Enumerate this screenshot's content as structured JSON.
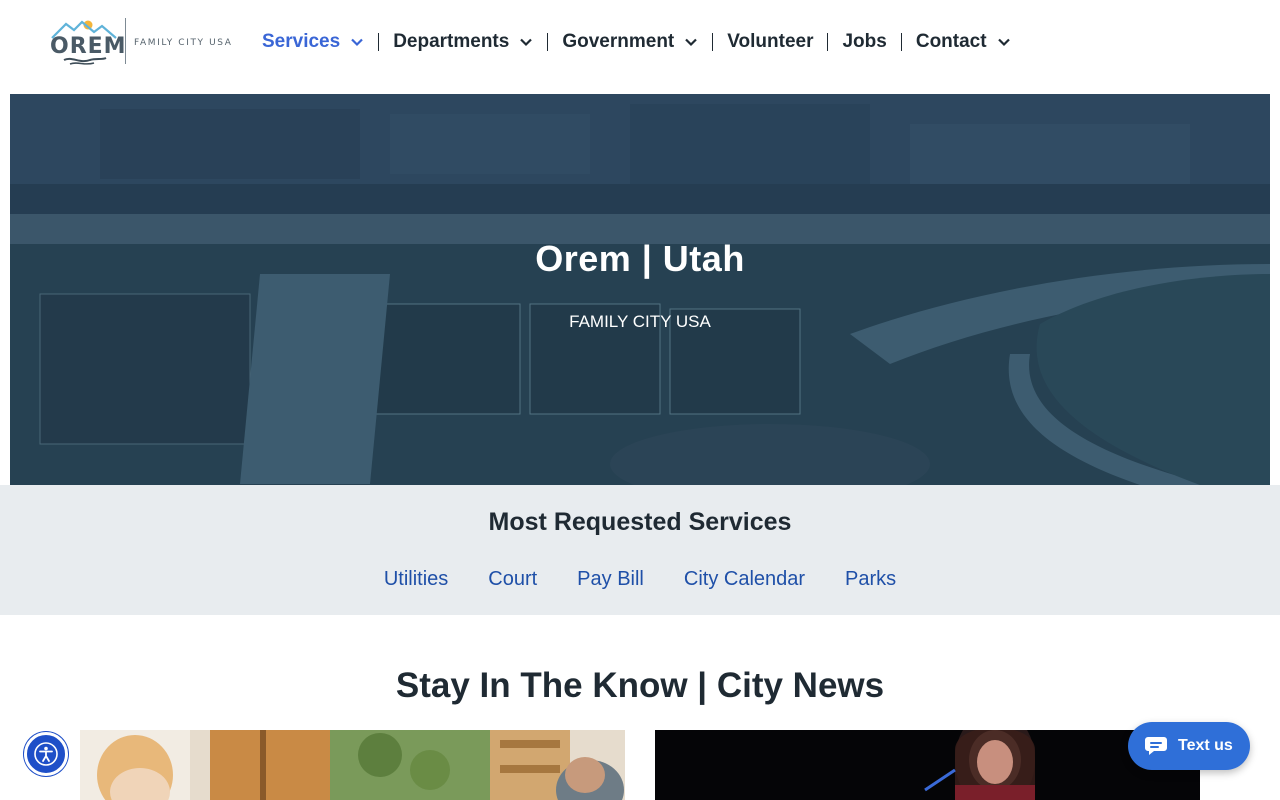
{
  "header": {
    "logo_text": "OREM",
    "logo_tagline": "FAMILY CITY USA",
    "nav": [
      {
        "label": "Services",
        "has_dropdown": true,
        "active": true
      },
      {
        "label": "Departments",
        "has_dropdown": true,
        "active": false
      },
      {
        "label": "Government",
        "has_dropdown": true,
        "active": false
      },
      {
        "label": "Volunteer",
        "has_dropdown": false,
        "active": false
      },
      {
        "label": "Jobs",
        "has_dropdown": false,
        "active": false
      },
      {
        "label": "Contact",
        "has_dropdown": true,
        "active": false
      }
    ]
  },
  "hero": {
    "title": "Orem | Utah",
    "subtitle": "FAMILY CITY USA"
  },
  "most_requested": {
    "title": "Most Requested Services",
    "links": [
      "Utilities",
      "Court",
      "Pay Bill",
      "City Calendar",
      "Parks"
    ]
  },
  "news": {
    "title": "Stay In The Know | City News"
  },
  "widgets": {
    "text_us_label": "Text us",
    "chat_icon": "chat-bubble-icon",
    "accessibility_icon": "accessibility-icon"
  },
  "colors": {
    "nav_active": "#3a66d6",
    "link": "#1f50a8",
    "band_bg": "#e8ecef",
    "text_us_bg": "#2f6fd8",
    "a11y_bg": "#1e4fc8"
  }
}
